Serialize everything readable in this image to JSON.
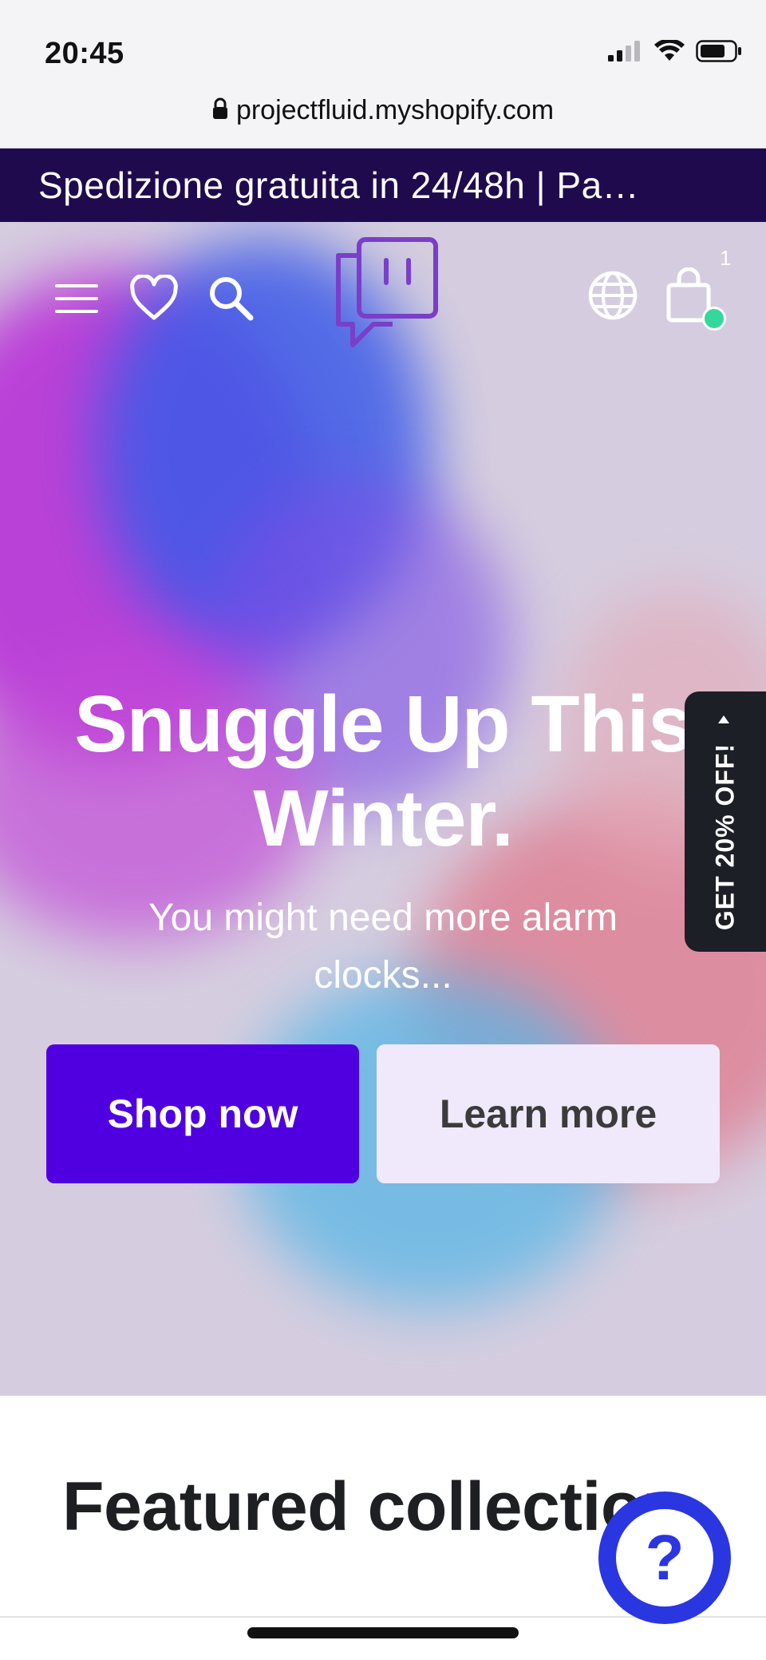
{
  "status_bar": {
    "time": "20:45",
    "icons": [
      "cellular-signal-icon",
      "wifi-icon",
      "battery-icon"
    ]
  },
  "browser": {
    "url": "projectfluid.myshopify.com",
    "lock_icon": "lock-icon"
  },
  "announcement": {
    "text": "Spedizione gratuita in 24/48h | Pa…"
  },
  "nav": {
    "menu_icon": "menu-icon",
    "wishlist_icon": "heart-icon",
    "search_icon": "search-icon",
    "logo_icon": "chat-face-logo-icon",
    "language_icon": "globe-icon",
    "cart_icon": "shopping-bag-icon",
    "cart_count": "1"
  },
  "hero": {
    "title": "Snuggle Up This\nWinter.",
    "subtitle": "You might need more alarm clocks...",
    "primary_button": "Shop now",
    "secondary_button": "Learn more"
  },
  "side_tab": {
    "label": "GET 20% OFF!"
  },
  "featured": {
    "title": "Featured collection"
  },
  "help": {
    "label": "?"
  },
  "colors": {
    "announcement_bg": "#200a4e",
    "primary_button": "#5000e0",
    "secondary_button": "#efe9fb",
    "hero_bg": "#d5cddf",
    "cart_dot": "#35d89c",
    "help_button": "#2a36e0",
    "logo": "#7a3fc8"
  }
}
